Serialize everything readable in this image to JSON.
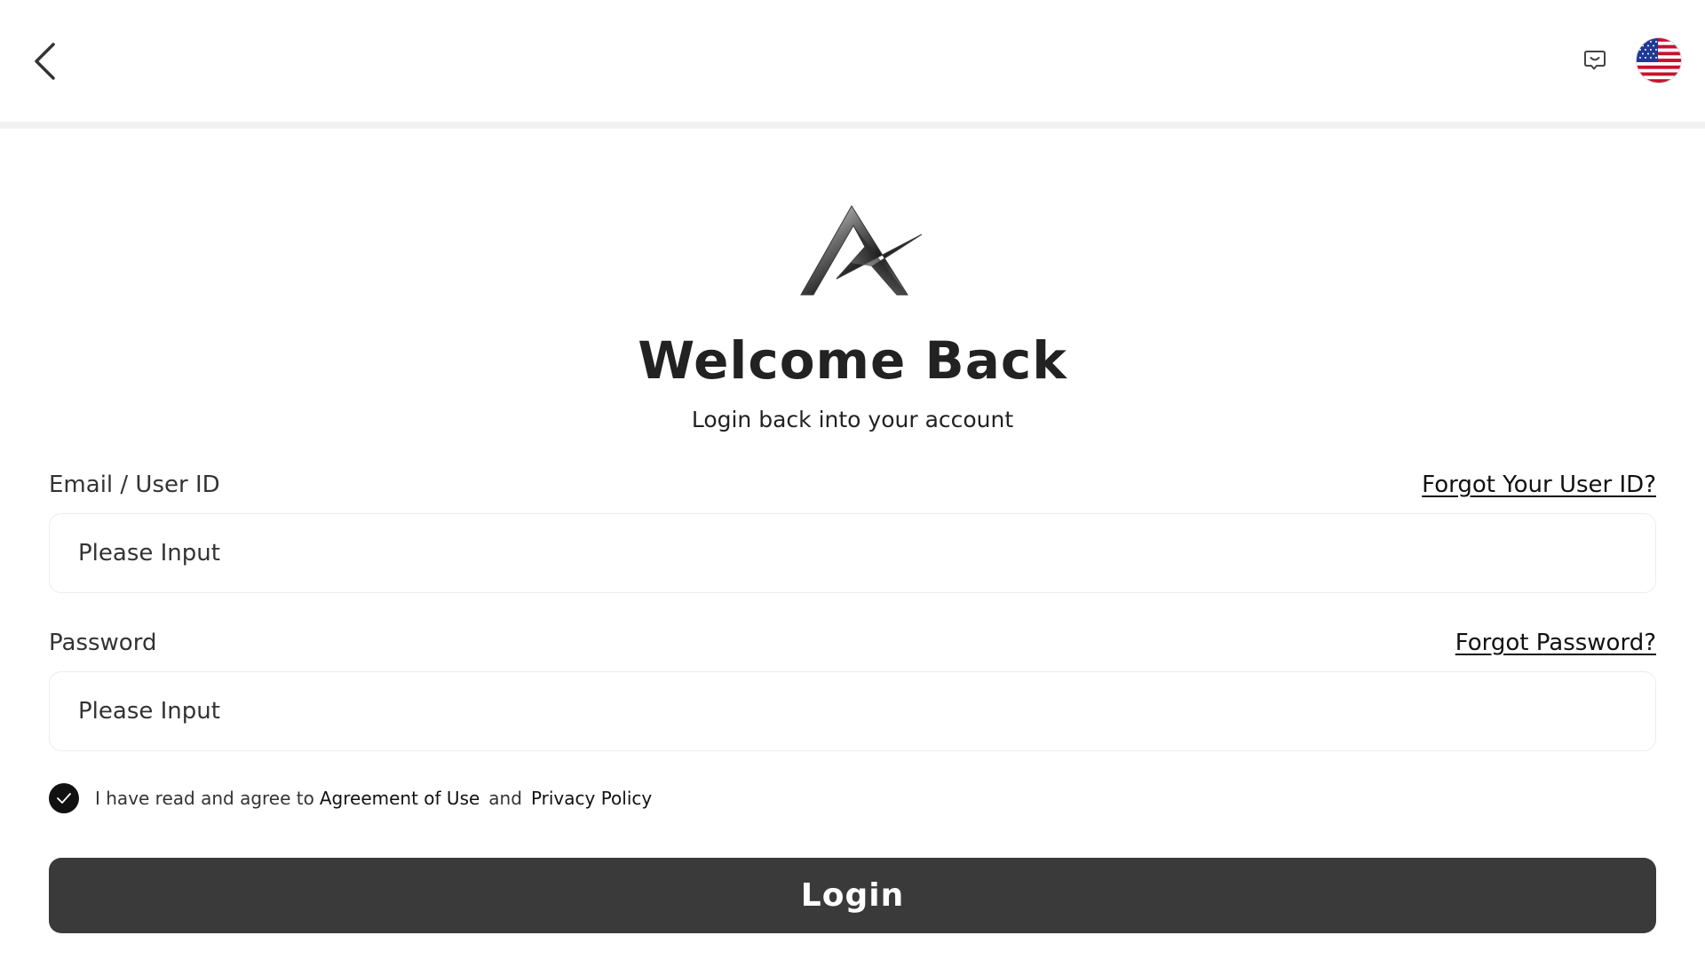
{
  "header": {
    "back_icon": "chevron-left-icon",
    "support_icon": "chat-support-icon",
    "language_icon": "us-flag-icon"
  },
  "hero": {
    "logo_icon": "brand-logo",
    "title": "Welcome Back",
    "subtitle": "Login back into your account"
  },
  "form": {
    "email": {
      "label": "Email / User ID",
      "forgot_label": "Forgot Your User ID?",
      "placeholder": "Please Input",
      "value": ""
    },
    "password": {
      "label": "Password",
      "forgot_label": "Forgot Password?",
      "placeholder": "Please Input",
      "value": ""
    },
    "agreement": {
      "checked": true,
      "prefix": "I have read and agree to",
      "terms_label": "Agreement of Use",
      "conjunction": "and",
      "privacy_label": "Privacy Policy"
    },
    "login_label": "Login"
  },
  "colors": {
    "button_bg": "#3a3a3a",
    "text": "#222222",
    "border": "#ececec"
  }
}
